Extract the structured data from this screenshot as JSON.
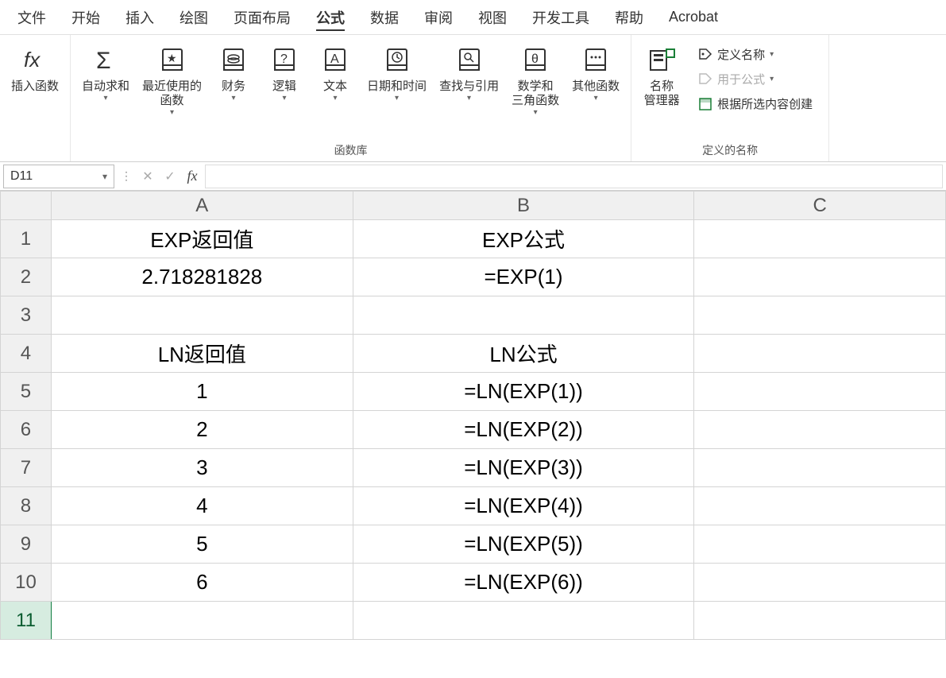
{
  "menu": {
    "items": [
      "文件",
      "开始",
      "插入",
      "绘图",
      "页面布局",
      "公式",
      "数据",
      "审阅",
      "视图",
      "开发工具",
      "帮助",
      "Acrobat"
    ],
    "active_index": 5
  },
  "ribbon": {
    "insert_fn_label": "插入函数",
    "autosum_label": "自动求和",
    "recent_label": "最近使用的\n函数",
    "financial_label": "财务",
    "logical_label": "逻辑",
    "text_label": "文本",
    "datetime_label": "日期和时间",
    "lookup_label": "查找与引用",
    "math_label": "数学和\n三角函数",
    "more_label": "其他函数",
    "group_functions_label": "函数库",
    "name_mgr_label": "名称\n管理器",
    "define_name_label": "定义名称",
    "use_in_formula_label": "用于公式",
    "create_from_sel_label": "根据所选内容创建",
    "group_names_label": "定义的名称"
  },
  "formula_bar": {
    "name_box_value": "D11",
    "input_value": ""
  },
  "grid": {
    "columns": [
      "A",
      "B",
      "C"
    ],
    "rows": [
      "1",
      "2",
      "3",
      "4",
      "5",
      "6",
      "7",
      "8",
      "9",
      "10",
      "11"
    ],
    "selected_cell": {
      "row_index": 10,
      "col_index": 3
    },
    "cells": {
      "A1": "EXP返回值",
      "B1": "EXP公式",
      "A2": "2.718281828",
      "B2": "=EXP(1)",
      "A4": "LN返回值",
      "B4": "LN公式",
      "A5": "1",
      "B5": "=LN(EXP(1))",
      "A6": "2",
      "B6": "=LN(EXP(2))",
      "A7": "3",
      "B7": "=LN(EXP(3))",
      "A8": "4",
      "B8": "=LN(EXP(4))",
      "A9": "5",
      "B9": "=LN(EXP(5))",
      "A10": "6",
      "B10": "=LN(EXP(6))"
    }
  }
}
